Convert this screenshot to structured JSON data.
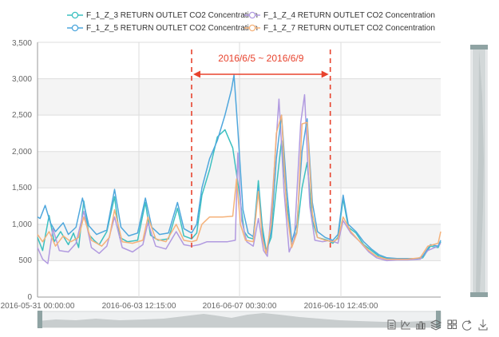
{
  "chart_data": {
    "type": "line",
    "title": "",
    "ylim": [
      0,
      3500
    ],
    "y_ticks": [
      0,
      500,
      1000,
      1500,
      2000,
      2500,
      3000,
      3500
    ],
    "y_tick_labels": [
      "0",
      "500",
      "1,000",
      "1,500",
      "2,000",
      "2,500",
      "3,000",
      "3,500"
    ],
    "x_axis": {
      "type": "time",
      "start": "2016-05-31 00:00:00",
      "end": "2016-06-13 02:00:00"
    },
    "x_tick_labels": [
      "2016-05-31 00:00:00",
      "2016-06-03 12:15:00",
      "2016-06-07 00:30:00",
      "2016-06-10 12:45:00"
    ],
    "grid": "horizontal bands",
    "legend_position": "top",
    "annotation": {
      "text": "2016/6/5 ~ 2016/6/9",
      "start": "2016-06-05 00:00:00",
      "end": "2016-06-09 12:00:00",
      "color": "#e8432e"
    },
    "series": [
      {
        "name": "F_1_Z_3 RETURN OUTLET CO2 Concentration",
        "color": "#3cc0c0",
        "points": [
          [
            "2016-05-31 00:00",
            820
          ],
          [
            "2016-05-31 04:00",
            640
          ],
          [
            "2016-05-31 09:00",
            1120
          ],
          [
            "2016-05-31 13:00",
            760
          ],
          [
            "2016-05-31 18:00",
            900
          ],
          [
            "2016-06-01 00:00",
            720
          ],
          [
            "2016-06-01 04:00",
            880
          ],
          [
            "2016-06-01 08:00",
            680
          ],
          [
            "2016-06-01 12:00",
            1320
          ],
          [
            "2016-06-01 16:00",
            860
          ],
          [
            "2016-06-01 20:00",
            780
          ],
          [
            "2016-06-02 00:00",
            720
          ],
          [
            "2016-06-02 06:00",
            900
          ],
          [
            "2016-06-02 12:00",
            1380
          ],
          [
            "2016-06-02 16:00",
            820
          ],
          [
            "2016-06-02 22:00",
            760
          ],
          [
            "2016-06-03 06:00",
            780
          ],
          [
            "2016-06-03 12:00",
            1300
          ],
          [
            "2016-06-03 16:00",
            850
          ],
          [
            "2016-06-03 22:00",
            780
          ],
          [
            "2016-06-04 06:00",
            800
          ],
          [
            "2016-06-04 13:00",
            1220
          ],
          [
            "2016-06-04 18:00",
            840
          ],
          [
            "2016-06-05 00:00",
            800
          ],
          [
            "2016-06-05 04:00",
            880
          ],
          [
            "2016-06-05 08:00",
            1400
          ],
          [
            "2016-06-05 14:00",
            1750
          ],
          [
            "2016-06-05 20:00",
            2200
          ],
          [
            "2016-06-06 02:00",
            2300
          ],
          [
            "2016-06-06 08:00",
            2050
          ],
          [
            "2016-06-06 13:00",
            1450
          ],
          [
            "2016-06-06 17:00",
            900
          ],
          [
            "2016-06-06 20:00",
            820
          ],
          [
            "2016-06-07 00:00",
            800
          ],
          [
            "2016-06-07 04:00",
            1600
          ],
          [
            "2016-06-07 07:00",
            980
          ],
          [
            "2016-06-07 10:00",
            640
          ],
          [
            "2016-06-07 14:00",
            820
          ],
          [
            "2016-06-07 18:00",
            1500
          ],
          [
            "2016-06-07 22:00",
            2150
          ],
          [
            "2016-06-08 02:00",
            1300
          ],
          [
            "2016-06-08 06:00",
            700
          ],
          [
            "2016-06-08 10:00",
            900
          ],
          [
            "2016-06-08 14:00",
            1500
          ],
          [
            "2016-06-08 18:00",
            1850
          ],
          [
            "2016-06-08 22:00",
            1050
          ],
          [
            "2016-06-09 02:00",
            820
          ],
          [
            "2016-06-09 06:00",
            800
          ],
          [
            "2016-06-09 10:00",
            780
          ],
          [
            "2016-06-09 14:00",
            740
          ],
          [
            "2016-06-09 18:00",
            820
          ],
          [
            "2016-06-09 22:00",
            1350
          ],
          [
            "2016-06-10 02:00",
            960
          ],
          [
            "2016-06-10 08:00",
            880
          ],
          [
            "2016-06-10 14:00",
            720
          ],
          [
            "2016-06-10 20:00",
            640
          ],
          [
            "2016-06-11 02:00",
            560
          ],
          [
            "2016-06-11 08:00",
            530
          ],
          [
            "2016-06-11 16:00",
            520
          ],
          [
            "2016-06-12 00:00",
            520
          ],
          [
            "2016-06-12 08:00",
            520
          ],
          [
            "2016-06-12 12:00",
            540
          ],
          [
            "2016-06-12 18:00",
            700
          ],
          [
            "2016-06-13 00:00",
            680
          ],
          [
            "2016-06-13 02:00",
            760
          ]
        ]
      },
      {
        "name": "F_1_Z_4 RETURN OUTLET CO2 Concentration",
        "color": "#b19ae0",
        "points": [
          [
            "2016-05-31 00:00",
            680
          ],
          [
            "2016-05-31 04:00",
            520
          ],
          [
            "2016-05-31 08:00",
            460
          ],
          [
            "2016-05-31 12:00",
            940
          ],
          [
            "2016-05-31 17:00",
            640
          ],
          [
            "2016-06-01 00:00",
            620
          ],
          [
            "2016-06-01 06:00",
            740
          ],
          [
            "2016-06-01 12:00",
            1180
          ],
          [
            "2016-06-01 18:00",
            680
          ],
          [
            "2016-06-02 00:00",
            600
          ],
          [
            "2016-06-02 06:00",
            700
          ],
          [
            "2016-06-02 12:00",
            1100
          ],
          [
            "2016-06-02 18:00",
            680
          ],
          [
            "2016-06-03 02:00",
            620
          ],
          [
            "2016-06-03 10:00",
            720
          ],
          [
            "2016-06-03 14:00",
            1020
          ],
          [
            "2016-06-03 20:00",
            700
          ],
          [
            "2016-06-04 04:00",
            660
          ],
          [
            "2016-06-04 12:00",
            900
          ],
          [
            "2016-06-04 18:00",
            720
          ],
          [
            "2016-06-05 00:00",
            700
          ],
          [
            "2016-06-05 06:00",
            720
          ],
          [
            "2016-06-05 12:00",
            760
          ],
          [
            "2016-06-05 20:00",
            760
          ],
          [
            "2016-06-06 04:00",
            760
          ],
          [
            "2016-06-06 10:00",
            780
          ],
          [
            "2016-06-06 12:00",
            1980
          ],
          [
            "2016-06-06 15:00",
            1050
          ],
          [
            "2016-06-06 19:00",
            760
          ],
          [
            "2016-06-07 00:00",
            700
          ],
          [
            "2016-06-07 04:00",
            1080
          ],
          [
            "2016-06-07 08:00",
            640
          ],
          [
            "2016-06-07 11:00",
            560
          ],
          [
            "2016-06-07 15:00",
            1400
          ],
          [
            "2016-06-07 20:00",
            2720
          ],
          [
            "2016-06-08 00:00",
            1450
          ],
          [
            "2016-06-08 04:00",
            620
          ],
          [
            "2016-06-08 08:00",
            800
          ],
          [
            "2016-06-08 13:00",
            2400
          ],
          [
            "2016-06-08 16:00",
            2780
          ],
          [
            "2016-06-08 20:00",
            1250
          ],
          [
            "2016-06-09 00:00",
            780
          ],
          [
            "2016-06-09 06:00",
            760
          ],
          [
            "2016-06-09 12:00",
            780
          ],
          [
            "2016-06-09 18:00",
            740
          ],
          [
            "2016-06-09 22:00",
            1050
          ],
          [
            "2016-06-10 04:00",
            880
          ],
          [
            "2016-06-10 10:00",
            780
          ],
          [
            "2016-06-10 18:00",
            620
          ],
          [
            "2016-06-11 00:00",
            540
          ],
          [
            "2016-06-11 08:00",
            500
          ],
          [
            "2016-06-11 16:00",
            510
          ],
          [
            "2016-06-12 00:00",
            510
          ],
          [
            "2016-06-12 10:00",
            520
          ],
          [
            "2016-06-12 16:00",
            640
          ],
          [
            "2016-06-13 00:00",
            700
          ],
          [
            "2016-06-13 02:00",
            740
          ]
        ]
      },
      {
        "name": "F_1_Z_5 RETURN OUTLET CO2 Concentration",
        "color": "#4fa7dd",
        "points": [
          [
            "2016-05-31 00:00",
            1100
          ],
          [
            "2016-05-31 02:00",
            1080
          ],
          [
            "2016-05-31 06:00",
            1260
          ],
          [
            "2016-05-31 10:00",
            1020
          ],
          [
            "2016-05-31 14:00",
            900
          ],
          [
            "2016-05-31 20:00",
            1020
          ],
          [
            "2016-06-01 00:00",
            860
          ],
          [
            "2016-06-01 06:00",
            960
          ],
          [
            "2016-06-01 11:00",
            1360
          ],
          [
            "2016-06-01 16:00",
            980
          ],
          [
            "2016-06-01 22:00",
            860
          ],
          [
            "2016-06-02 06:00",
            920
          ],
          [
            "2016-06-02 12:00",
            1480
          ],
          [
            "2016-06-02 17:00",
            960
          ],
          [
            "2016-06-02 23:00",
            840
          ],
          [
            "2016-06-03 06:00",
            880
          ],
          [
            "2016-06-03 12:00",
            1360
          ],
          [
            "2016-06-03 17:00",
            960
          ],
          [
            "2016-06-03 23:00",
            860
          ],
          [
            "2016-06-04 06:00",
            880
          ],
          [
            "2016-06-04 13:00",
            1300
          ],
          [
            "2016-06-04 18:00",
            940
          ],
          [
            "2016-06-05 00:00",
            880
          ],
          [
            "2016-06-05 04:00",
            1000
          ],
          [
            "2016-06-05 08:00",
            1500
          ],
          [
            "2016-06-05 14:00",
            1900
          ],
          [
            "2016-06-05 20:00",
            2150
          ],
          [
            "2016-06-06 02:00",
            2500
          ],
          [
            "2016-06-06 07:00",
            2850
          ],
          [
            "2016-06-06 09:00",
            3050
          ],
          [
            "2016-06-06 12:00",
            2300
          ],
          [
            "2016-06-06 16:00",
            1200
          ],
          [
            "2016-06-06 20:00",
            880
          ],
          [
            "2016-06-07 00:00",
            830
          ],
          [
            "2016-06-07 04:00",
            1500
          ],
          [
            "2016-06-07 07:00",
            900
          ],
          [
            "2016-06-07 10:00",
            600
          ],
          [
            "2016-06-07 14:00",
            900
          ],
          [
            "2016-06-07 18:00",
            1900
          ],
          [
            "2016-06-07 22:00",
            2500
          ],
          [
            "2016-06-08 02:00",
            1500
          ],
          [
            "2016-06-08 06:00",
            760
          ],
          [
            "2016-06-08 10:00",
            1000
          ],
          [
            "2016-06-08 14:00",
            2000
          ],
          [
            "2016-06-08 18:00",
            2450
          ],
          [
            "2016-06-08 22:00",
            1300
          ],
          [
            "2016-06-09 02:00",
            900
          ],
          [
            "2016-06-09 08:00",
            820
          ],
          [
            "2016-06-09 14:00",
            780
          ],
          [
            "2016-06-09 18:00",
            860
          ],
          [
            "2016-06-09 22:00",
            1400
          ],
          [
            "2016-06-10 02:00",
            1000
          ],
          [
            "2016-06-10 08:00",
            900
          ],
          [
            "2016-06-10 14:00",
            760
          ],
          [
            "2016-06-10 20:00",
            660
          ],
          [
            "2016-06-11 02:00",
            580
          ],
          [
            "2016-06-11 08:00",
            540
          ],
          [
            "2016-06-11 16:00",
            530
          ],
          [
            "2016-06-12 00:00",
            530
          ],
          [
            "2016-06-12 08:00",
            530
          ],
          [
            "2016-06-12 12:00",
            560
          ],
          [
            "2016-06-12 18:00",
            720
          ],
          [
            "2016-06-13 00:00",
            700
          ],
          [
            "2016-06-13 02:00",
            780
          ]
        ]
      },
      {
        "name": "F_1_Z_7 RETURN OUTLET CO2 Concentration",
        "color": "#f5b27a",
        "points": [
          [
            "2016-05-31 00:00",
            860
          ],
          [
            "2016-05-31 04:00",
            760
          ],
          [
            "2016-05-31 09:00",
            900
          ],
          [
            "2016-05-31 14:00",
            700
          ],
          [
            "2016-05-31 20:00",
            840
          ],
          [
            "2016-06-01 02:00",
            760
          ],
          [
            "2016-06-01 08:00",
            820
          ],
          [
            "2016-06-01 12:00",
            1100
          ],
          [
            "2016-06-01 18:00",
            780
          ],
          [
            "2016-06-02 02:00",
            700
          ],
          [
            "2016-06-02 08:00",
            820
          ],
          [
            "2016-06-02 12:00",
            1200
          ],
          [
            "2016-06-02 18:00",
            760
          ],
          [
            "2016-06-03 02:00",
            740
          ],
          [
            "2016-06-03 10:00",
            780
          ],
          [
            "2016-06-03 14:00",
            1100
          ],
          [
            "2016-06-03 20:00",
            800
          ],
          [
            "2016-06-04 04:00",
            760
          ],
          [
            "2016-06-04 12:00",
            1000
          ],
          [
            "2016-06-04 18:00",
            780
          ],
          [
            "2016-06-05 00:00",
            760
          ],
          [
            "2016-06-05 04:00",
            780
          ],
          [
            "2016-06-05 08:00",
            1000
          ],
          [
            "2016-06-05 14:00",
            1100
          ],
          [
            "2016-06-06 00:00",
            1100
          ],
          [
            "2016-06-06 08:00",
            1110
          ],
          [
            "2016-06-06 11:00",
            1620
          ],
          [
            "2016-06-06 14:00",
            1000
          ],
          [
            "2016-06-06 18:00",
            780
          ],
          [
            "2016-06-07 00:00",
            760
          ],
          [
            "2016-06-07 04:00",
            1450
          ],
          [
            "2016-06-07 07:00",
            820
          ],
          [
            "2016-06-07 10:00",
            600
          ],
          [
            "2016-06-07 14:00",
            1000
          ],
          [
            "2016-06-07 18:00",
            2250
          ],
          [
            "2016-06-07 22:00",
            2500
          ],
          [
            "2016-06-08 02:00",
            1200
          ],
          [
            "2016-06-08 06:00",
            680
          ],
          [
            "2016-06-08 10:00",
            880
          ],
          [
            "2016-06-08 14:00",
            2380
          ],
          [
            "2016-06-08 18:00",
            2400
          ],
          [
            "2016-06-08 22:00",
            1150
          ],
          [
            "2016-06-09 02:00",
            820
          ],
          [
            "2016-06-09 08:00",
            780
          ],
          [
            "2016-06-09 14:00",
            760
          ],
          [
            "2016-06-09 18:00",
            800
          ],
          [
            "2016-06-09 22:00",
            1100
          ],
          [
            "2016-06-10 04:00",
            900
          ],
          [
            "2016-06-10 10:00",
            780
          ],
          [
            "2016-06-10 18:00",
            640
          ],
          [
            "2016-06-11 00:00",
            560
          ],
          [
            "2016-06-11 08:00",
            520
          ],
          [
            "2016-06-11 16:00",
            520
          ],
          [
            "2016-06-12 00:00",
            520
          ],
          [
            "2016-06-12 10:00",
            540
          ],
          [
            "2016-06-12 16:00",
            700
          ],
          [
            "2016-06-13 00:00",
            740
          ],
          [
            "2016-06-13 02:00",
            900
          ]
        ]
      }
    ]
  },
  "colors": {
    "band_fill": "#f4f4f4",
    "grid_line": "#dddddd",
    "axis_line": "#999999",
    "accent_red": "#e8432e",
    "slider_track": "#d8dcdd",
    "slider_handle": "#8fa3a3"
  },
  "toolbox": {
    "icons": [
      "data-view-icon",
      "line-chart-icon",
      "bar-chart-icon",
      "stack-icon",
      "tiled-icon",
      "restore-icon",
      "download-icon"
    ]
  }
}
